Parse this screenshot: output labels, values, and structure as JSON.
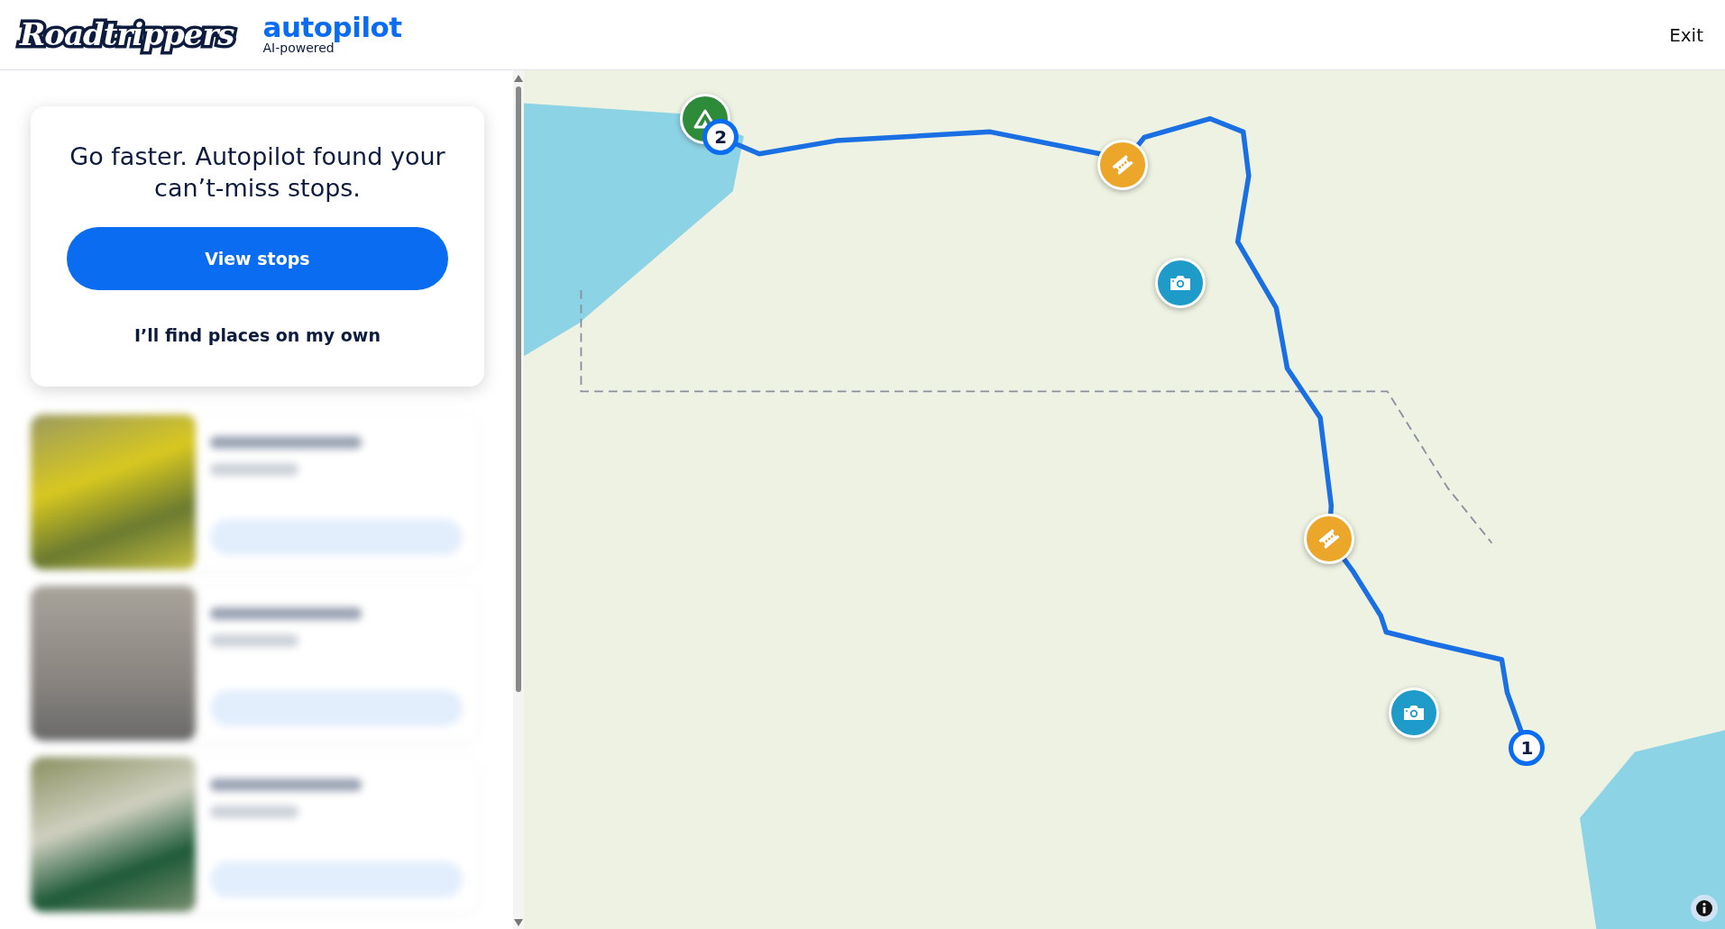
{
  "header": {
    "brand": "Roadtrippers",
    "product": "autopilot",
    "tagline": "AI-powered",
    "exit": "Exit"
  },
  "prompt": {
    "title": "Go faster. Autopilot found your can’t-miss stops.",
    "primary_button": "View stops",
    "secondary_link": "I’ll find places on my own"
  },
  "stop_cards": [
    {
      "blurred": true
    },
    {
      "blurred": true
    },
    {
      "blurred": true
    }
  ],
  "map": {
    "markers": [
      {
        "kind": "campsite"
      },
      {
        "kind": "waypoint",
        "label": "2"
      },
      {
        "kind": "ticket"
      },
      {
        "kind": "camera"
      },
      {
        "kind": "ticket"
      },
      {
        "kind": "camera"
      },
      {
        "kind": "waypoint",
        "label": "1"
      }
    ]
  }
}
